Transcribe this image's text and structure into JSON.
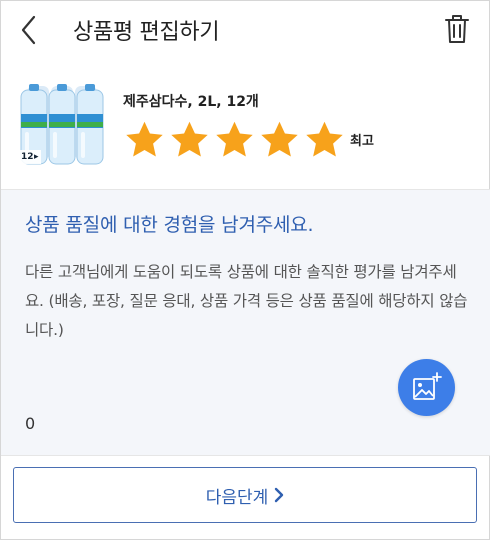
{
  "header": {
    "title": "상품평 편집하기",
    "back_icon": "chevron-left-icon",
    "delete_icon": "trash-icon"
  },
  "product": {
    "name": "제주삼다수, 2L, 12개",
    "thumb_badge": "12",
    "rating": 5,
    "rating_max": 5,
    "rating_label": "최고",
    "star_color": "#f7a21b"
  },
  "review": {
    "prompt": "상품 품질에 대한 경험을 남겨주세요.",
    "guide": "다른 고객님에게 도움이 되도록 상품에 대한 솔직한 평가를 남겨주세요. (배송, 포장, 질문 응대, 상품 가격 등은 상품 품질에 해당하지 않습니다.)",
    "char_count": "0",
    "photo_icon": "add-photo-icon",
    "accent_color": "#3d7ee8"
  },
  "footer": {
    "next_label": "다음단계"
  }
}
